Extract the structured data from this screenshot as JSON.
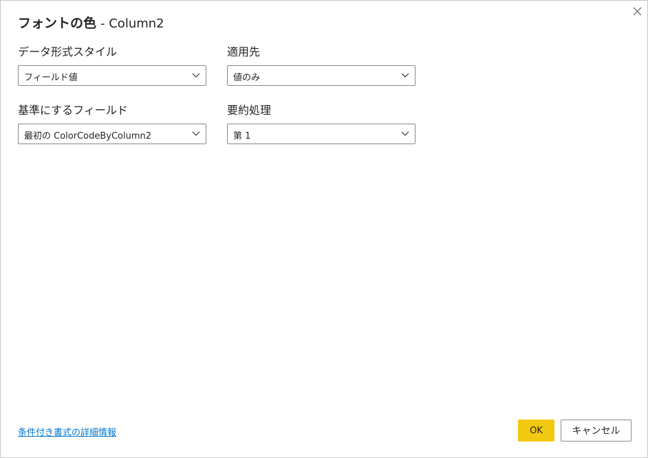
{
  "dialog": {
    "title": "フォントの色",
    "title_suffix": "- Column2"
  },
  "fields": {
    "format_style": {
      "label": "データ形式スタイル",
      "value": "フィールド値"
    },
    "apply_to": {
      "label": "適用先",
      "value": "値のみ"
    },
    "based_on_field": {
      "label": "基準にするフィールド",
      "value": "最初の ColorCodeByColumn2"
    },
    "summarization": {
      "label": "要約処理",
      "value": "第 1"
    }
  },
  "footer": {
    "help_link": "条件付き書式の詳細情報",
    "ok_label": "OK",
    "cancel_label": "キャンセル"
  },
  "colors": {
    "accent": "#f2c811",
    "link": "#0078d4",
    "border": "#8a8886"
  }
}
